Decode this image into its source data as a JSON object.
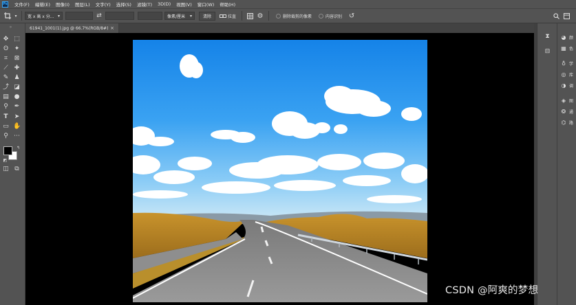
{
  "app": {
    "logo": "Ps"
  },
  "menu": [
    "文件(F)",
    "编辑(E)",
    "图像(I)",
    "图层(L)",
    "文字(Y)",
    "选择(S)",
    "滤镜(T)",
    "3D(D)",
    "视图(V)",
    "窗口(W)",
    "帮助(H)"
  ],
  "options": {
    "ratio_select": "宽 x 高 x 分...",
    "swap_icon": "swap-icon",
    "unit_select": "像素/厘米",
    "clear_label": "清除",
    "straighten_label": "拉直",
    "delete_cropped_label": "删除裁剪的像素",
    "content_aware_label": "内容识别"
  },
  "document": {
    "tab_label": "61941_1001(1).jpg @ 66.7%(RGB/8#)",
    "close_glyph": "×"
  },
  "panels": [
    {
      "icon": "color-icon",
      "label": "颜"
    },
    {
      "icon": "swatches-icon",
      "label": "色"
    },
    {
      "icon": "learn-icon",
      "label": "学"
    },
    {
      "icon": "libraries-icon",
      "label": "库"
    },
    {
      "icon": "adjustments-icon",
      "label": "调"
    },
    {
      "icon": "layers-icon",
      "label": "图"
    },
    {
      "icon": "channels-icon",
      "label": "通"
    },
    {
      "icon": "paths-icon",
      "label": "路"
    }
  ],
  "watermark": "CSDN @阿爽的梦想",
  "colors": {
    "ui_bg": "#535353",
    "canvas_bg": "#000000",
    "accent": "#31a8ff"
  }
}
